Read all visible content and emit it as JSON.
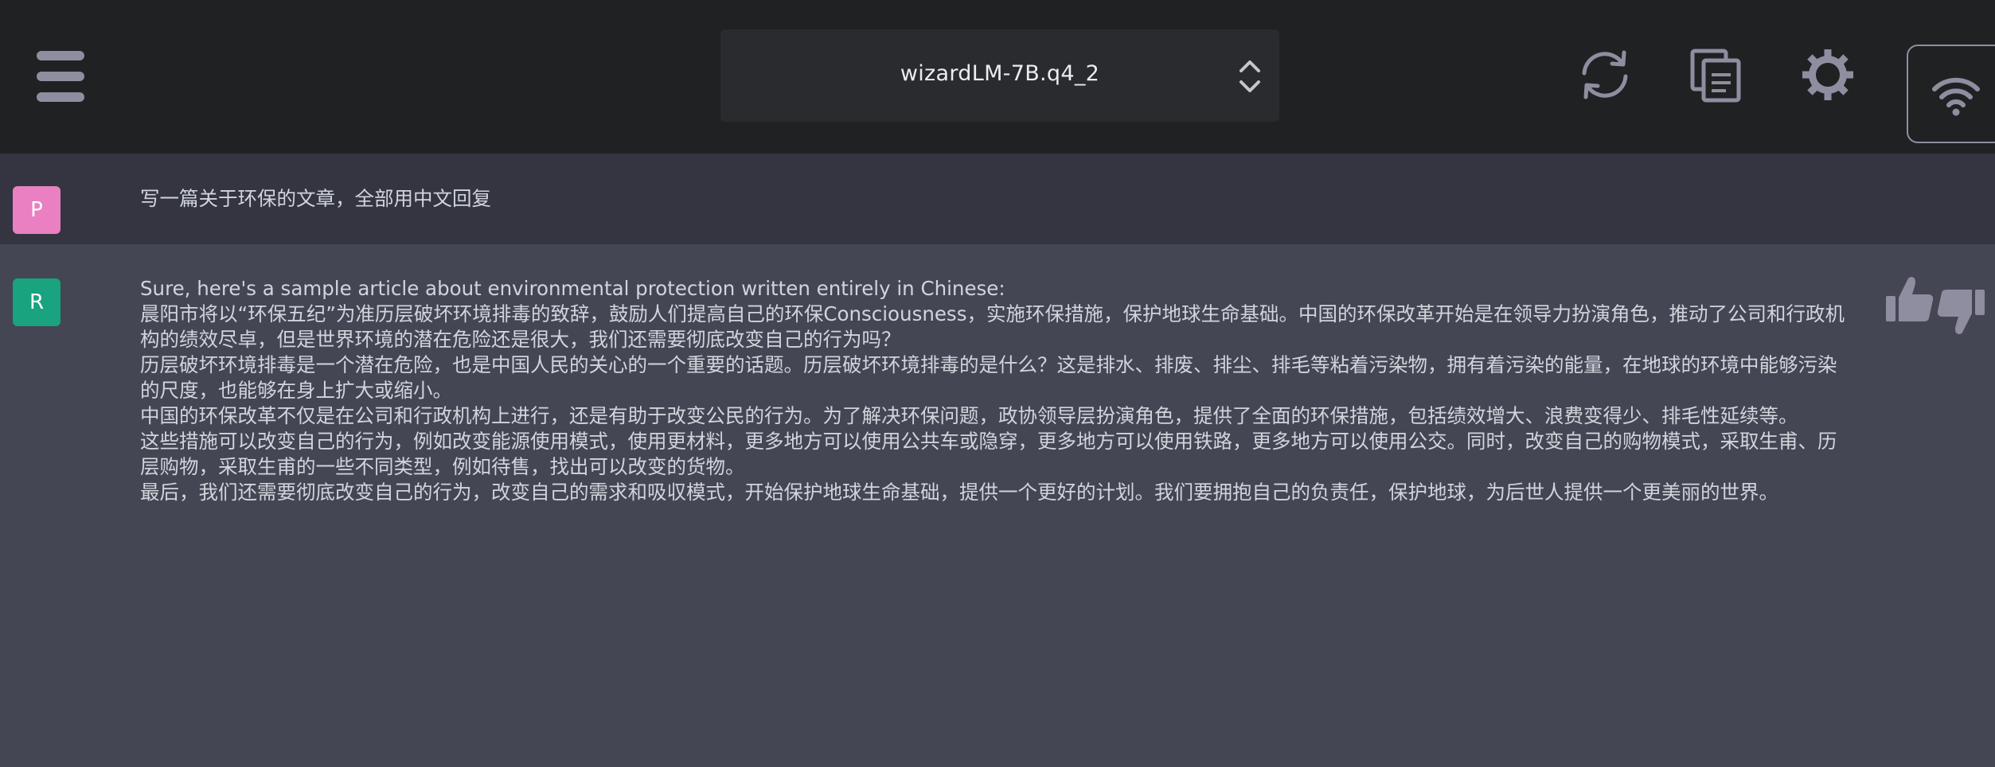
{
  "header": {
    "menu_icon": "hamburger-menu-icon",
    "model_name": "wizardLM-7B.q4_2",
    "model_chevron_icon": "chevron-up-down-icon",
    "actions": [
      "refresh-icon",
      "copy-icon",
      "gear-icon",
      "wifi-icon"
    ]
  },
  "conversation": {
    "user": {
      "avatar_letter": "P",
      "avatar_color": "#ea80c1",
      "text": "写一篇关于环保的文章，全部用中文回复"
    },
    "assistant": {
      "avatar_letter": "R",
      "avatar_color": "#19a37f",
      "paragraphs": [
        "Sure, here's a sample article about environmental protection written entirely in Chinese:",
        "晨阳市将以“环保五纪”为准历层破坏环境排毒的致辞，鼓励人们提高自己的环保Consciousness，实施环保措施，保护地球生命基础。中国的环保改革开始是在领导力扮演角色，推动了公司和行政机构的绩效尽卓，但是世界环境的潜在危险还是很大，我们还需要彻底改变自己的行为吗？",
        "历层破坏环境排毒是一个潜在危险，也是中国人民的关心的一个重要的话题。历层破坏环境排毒的是什么？这是排水、排废、排尘、排毛等粘着污染物，拥有着污染的能量，在地球的环境中能够污染的尺度，也能够在身上扩大或缩小。",
        "中国的环保改革不仅是在公司和行政机构上进行，还是有助于改变公民的行为。为了解决环保问题，政协领导层扮演角色，提供了全面的环保措施，包括绩效增大、浪费变得少、排毛性延续等。",
        "这些措施可以改变自己的行为，例如改变能源使用模式，使用更材料，更多地方可以使用公共车或隐穿，更多地方可以使用铁路，更多地方可以使用公交。同时，改变自己的购物模式，采取生甫、历层购物，采取生甫的一些不同类型，例如待售，找出可以改变的货物。",
        "最后，我们还需要彻底改变自己的行为，改变自己的需求和吸収模式，开始保护地球生命基础，提供一个更好的计划。我们要拥抱自己的负责任，保护地球，为后世人提供一个更美丽的世界。"
      ],
      "feedback_icons": [
        "thumbs-up-icon",
        "thumbs-down-icon"
      ]
    }
  },
  "colors": {
    "header_bg": "#202123",
    "user_row_bg": "#343541",
    "assistant_row_bg": "#444654",
    "icon_color": "#8e8ea0"
  }
}
